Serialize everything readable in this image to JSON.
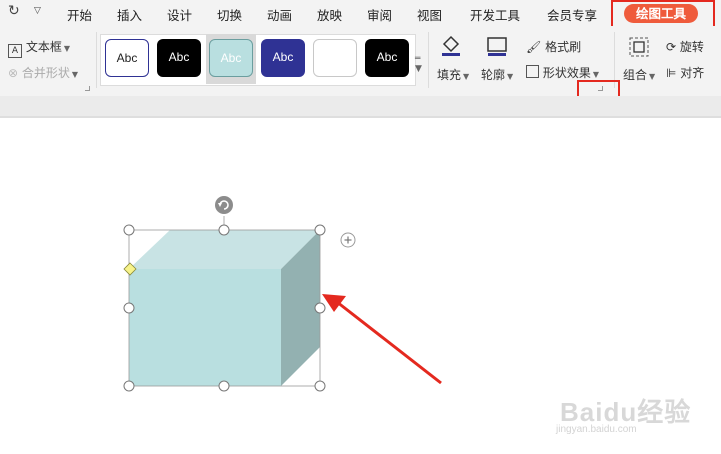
{
  "quick_access": {
    "redo_icon": "redo-icon",
    "dropdown_icon": "chevron-down-icon"
  },
  "tabs": [
    {
      "label": "开始"
    },
    {
      "label": "插入"
    },
    {
      "label": "设计"
    },
    {
      "label": "切换"
    },
    {
      "label": "动画"
    },
    {
      "label": "放映"
    },
    {
      "label": "审阅"
    },
    {
      "label": "视图"
    },
    {
      "label": "开发工具"
    },
    {
      "label": "会员专享"
    }
  ],
  "active_tab": {
    "label": "绘图工具",
    "color": "#ef5b3c"
  },
  "ribbon": {
    "textbox": "文本框",
    "merge_shapes": "合并形状",
    "shape_styles": [
      "Abc",
      "Abc",
      "Abc",
      "Abc",
      "",
      "Abc"
    ],
    "fill": "填充",
    "outline": "轮廓",
    "format_painter": "格式刷",
    "shape_effects": "形状效果",
    "group": "组合",
    "rotate": "旋转",
    "align": "对齐"
  },
  "colors": {
    "highlight": "#e4291f",
    "cube_front": "#b9dfe0",
    "cube_top": "#c8e3e4",
    "cube_side": "#93b1b1",
    "style_navy": "#2f3294"
  },
  "watermark": {
    "main": "Baidu经验",
    "sub": "jingyan.baidu.com"
  }
}
